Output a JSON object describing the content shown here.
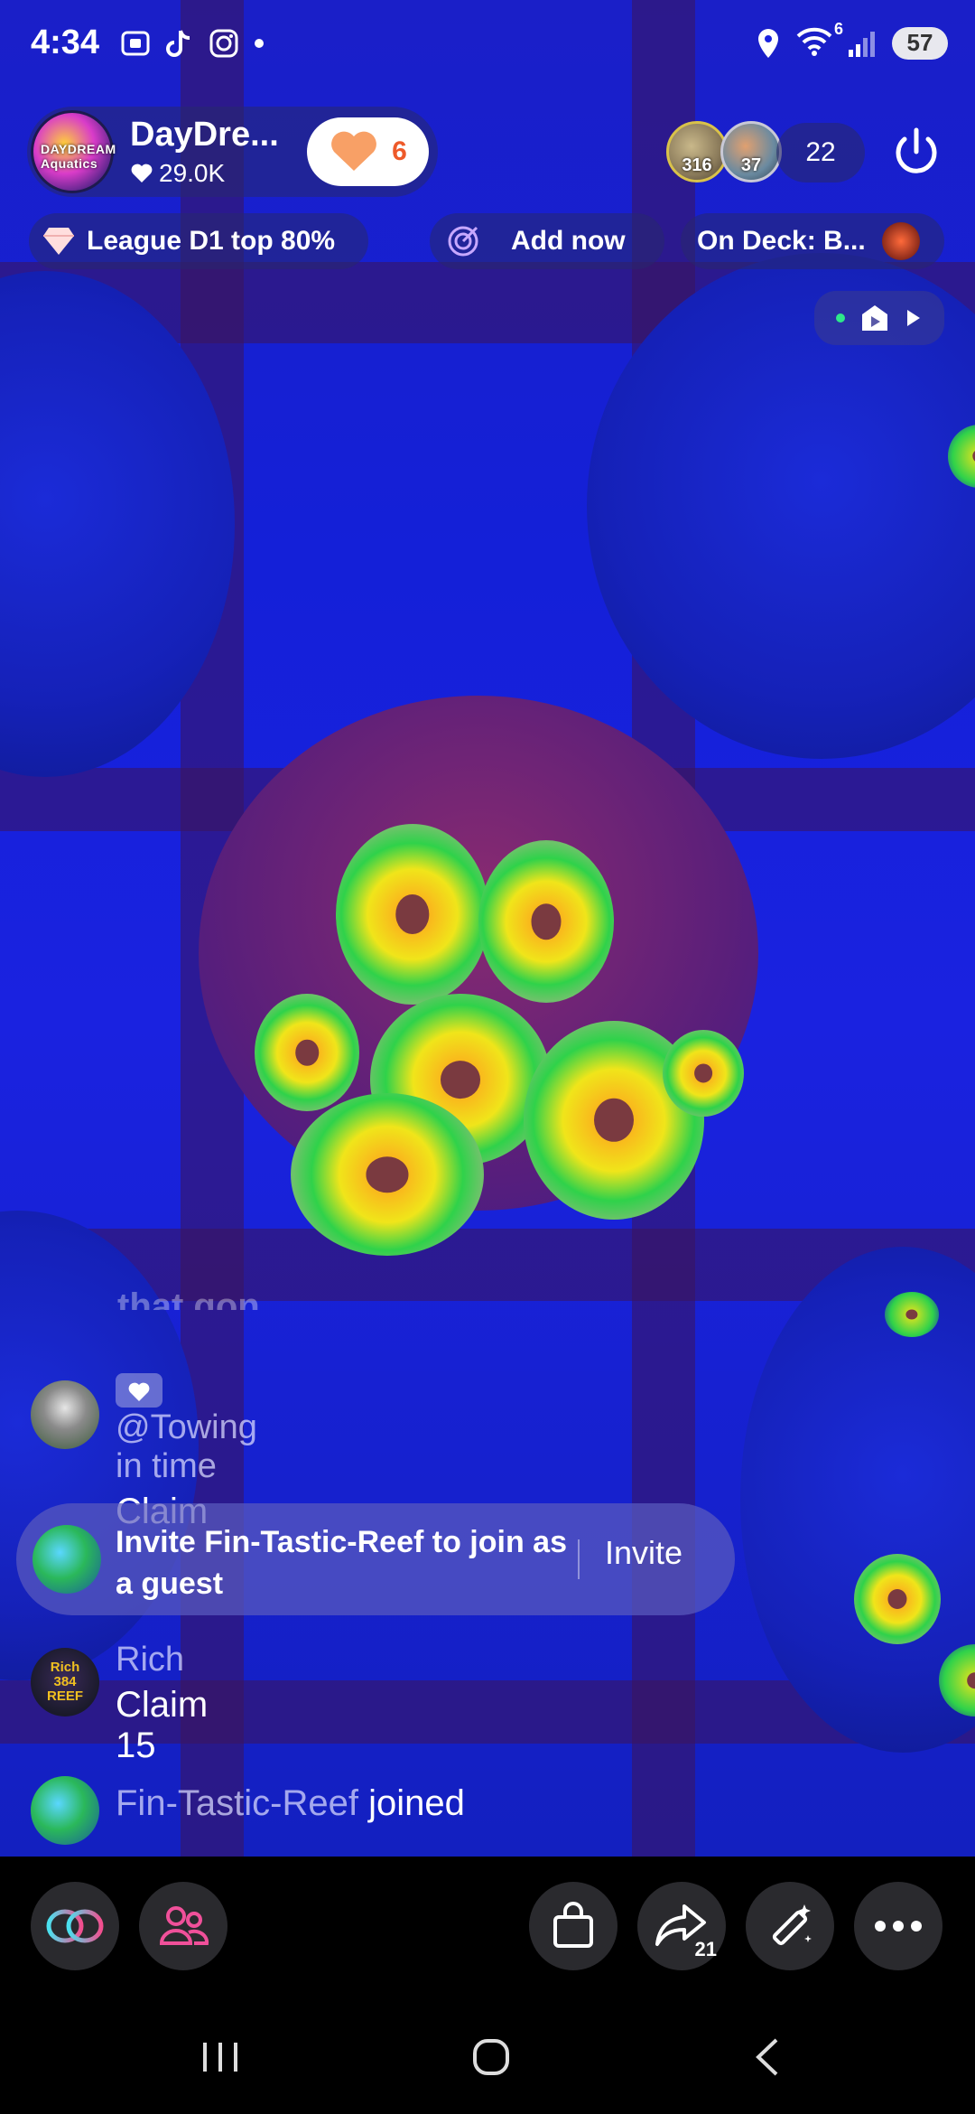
{
  "status_bar": {
    "time": "4:34",
    "battery": "57",
    "wifi_label": "6",
    "left_icons": [
      "screen-record-icon",
      "tiktok-icon",
      "instagram-icon",
      "dot-icon"
    ],
    "right_icons": [
      "location-icon",
      "wifi-icon",
      "signal-icon",
      "battery-icon"
    ]
  },
  "host": {
    "avatar_text": "DAYDREAM Aquatics",
    "name": "DayDre...",
    "likes": "29.0K",
    "follow_count": "6"
  },
  "viewers": {
    "avatar1_badge": "316",
    "avatar2_badge": "37",
    "count": "22"
  },
  "chips": {
    "league": "League D1 top 80%",
    "add_now": "Add now",
    "on_deck": "On Deck: B..."
  },
  "chat": {
    "faded_text": "that gon...",
    "messages": [
      {
        "name": "@Towing in time",
        "message": "Claim"
      },
      {
        "name": "Rich",
        "message": "Claim 15",
        "avatar_text": "Rich 384 REEF"
      }
    ],
    "invite": {
      "text": "Invite Fin-Tastic-Reef to join as a guest",
      "button": "Invite"
    },
    "joined": {
      "name": "Fin-Tastic-Reef",
      "action": "joined"
    }
  },
  "toolbar": {
    "share_count": "21",
    "icons": [
      "link-icon",
      "multi-guest-icon",
      "shop-bag-icon",
      "share-icon",
      "magic-wand-icon",
      "more-icon"
    ]
  },
  "colors": {
    "background_blue": "#1a22e0",
    "follow_accent": "#ee5a2a",
    "toolbar_bg": "#000000"
  }
}
